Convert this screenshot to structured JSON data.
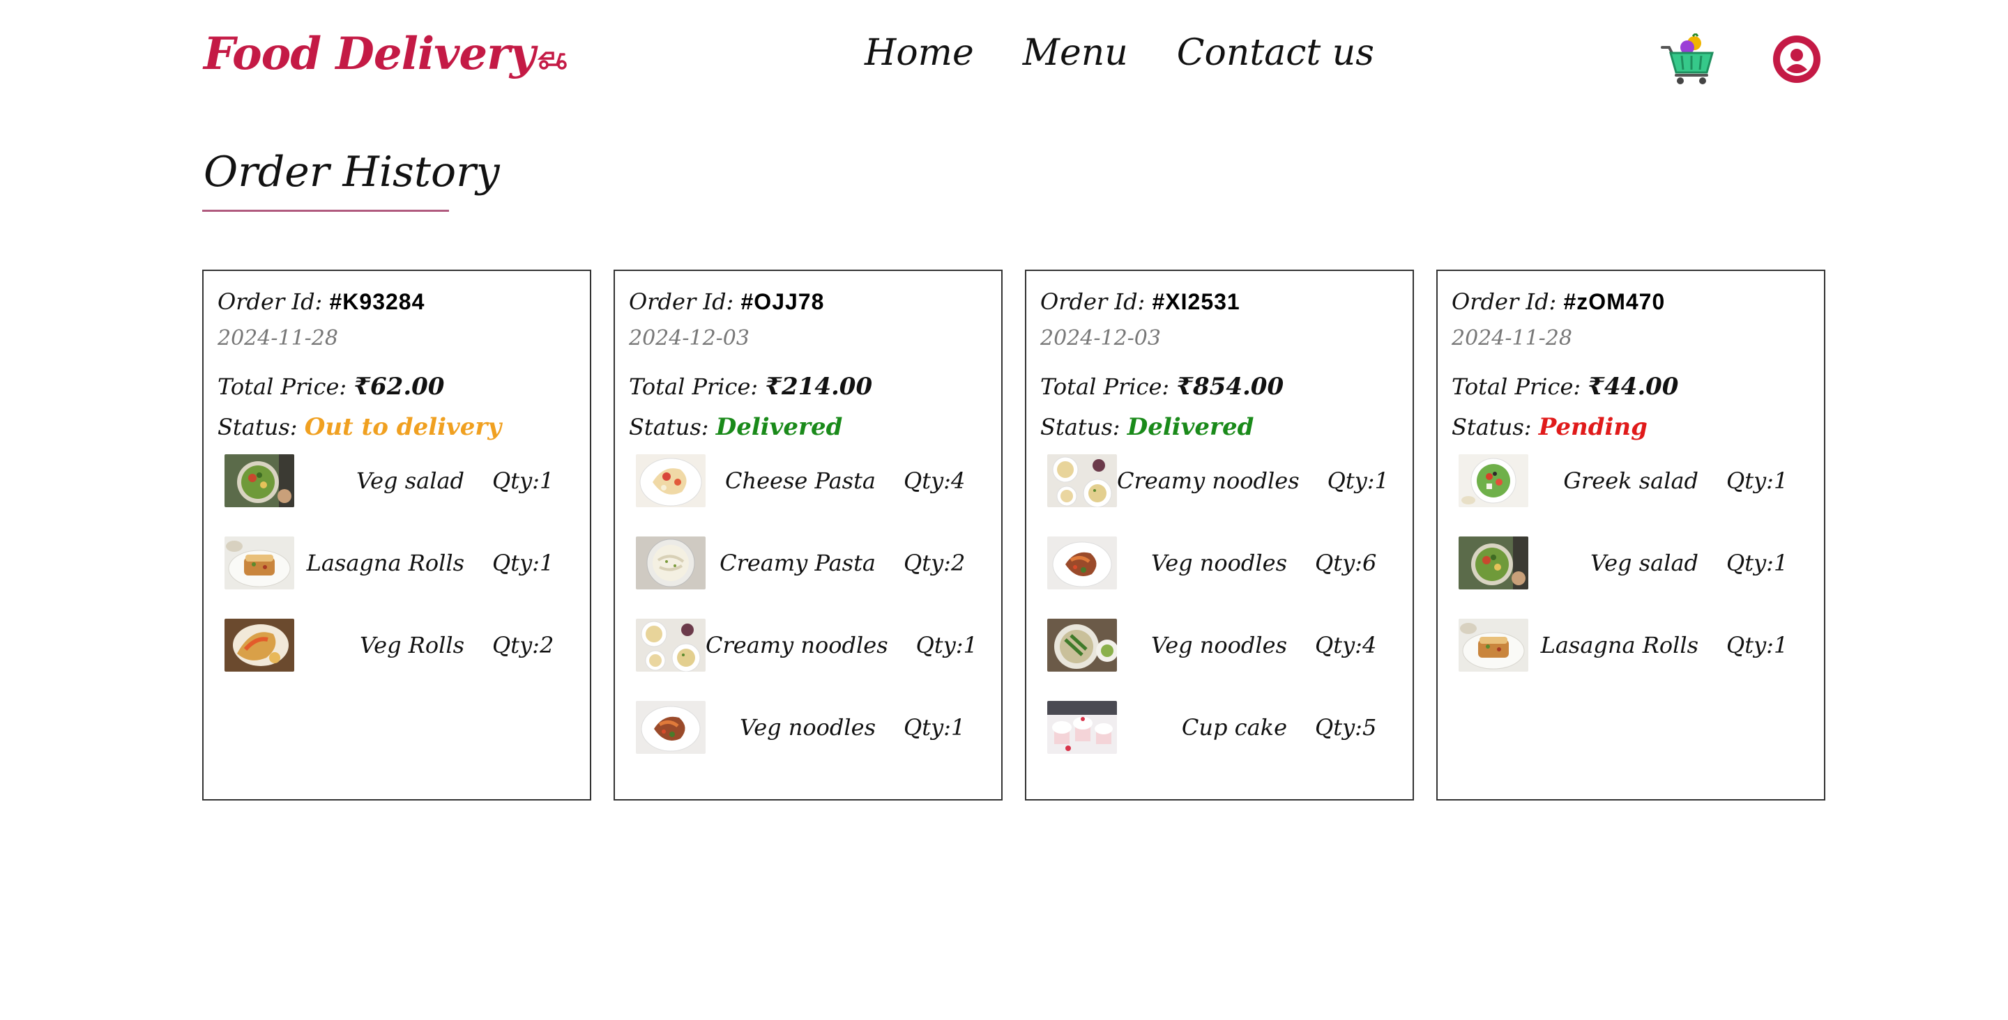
{
  "navbar": {
    "logo_text": "Food Delivery",
    "links": [
      "Home",
      "Menu",
      "Contact us"
    ],
    "brand_color": "#c41a45",
    "cart_icon": "shopping-cart-icon",
    "profile_icon": "user-profile-icon"
  },
  "page": {
    "title": "Order History"
  },
  "labels": {
    "order_id": "Order Id:",
    "total_price": "Total Price:",
    "status": "Status:"
  },
  "status_colors": {
    "Out to delivery": "#f0a020",
    "Delivered": "#1a8a1a",
    "Pending": "#e01a1a"
  },
  "orders": [
    {
      "id": "#K93284",
      "date": "2024-11-28",
      "total": "₹62.00",
      "status": "Out to delivery",
      "items": [
        {
          "name": "Veg salad",
          "qty": "Qty:1",
          "thumb": "salad-bowl"
        },
        {
          "name": "Lasagna Rolls",
          "qty": "Qty:1",
          "thumb": "lasagna-plate"
        },
        {
          "name": "Veg Rolls",
          "qty": "Qty:2",
          "thumb": "rolls"
        }
      ]
    },
    {
      "id": "#OJJ78",
      "date": "2024-12-03",
      "total": "₹214.00",
      "status": "Delivered",
      "items": [
        {
          "name": "Cheese Pasta",
          "qty": "Qty:4",
          "thumb": "pasta-plate"
        },
        {
          "name": "Creamy Pasta",
          "qty": "Qty:2",
          "thumb": "creamy-bowl"
        },
        {
          "name": "Creamy noodles",
          "qty": "Qty:1",
          "thumb": "noodle-plates"
        },
        {
          "name": "Veg noodles",
          "qty": "Qty:1",
          "thumb": "veg-noodle-plate"
        }
      ]
    },
    {
      "id": "#XI2531",
      "date": "2024-12-03",
      "total": "₹854.00",
      "status": "Delivered",
      "items": [
        {
          "name": "Creamy noodles",
          "qty": "Qty:1",
          "thumb": "noodle-plates"
        },
        {
          "name": "Veg noodles",
          "qty": "Qty:6",
          "thumb": "veg-noodle-plate"
        },
        {
          "name": "Veg noodles",
          "qty": "Qty:4",
          "thumb": "green-noodle-bowl"
        },
        {
          "name": "Cup cake",
          "qty": "Qty:5",
          "thumb": "cupcakes"
        }
      ]
    },
    {
      "id": "#zOM470",
      "date": "2024-11-28",
      "total": "₹44.00",
      "status": "Pending",
      "items": [
        {
          "name": "Greek salad",
          "qty": "Qty:1",
          "thumb": "greek-salad-bowl"
        },
        {
          "name": "Veg salad",
          "qty": "Qty:1",
          "thumb": "salad-bowl"
        },
        {
          "name": "Lasagna Rolls",
          "qty": "Qty:1",
          "thumb": "lasagna-plate"
        }
      ]
    }
  ]
}
